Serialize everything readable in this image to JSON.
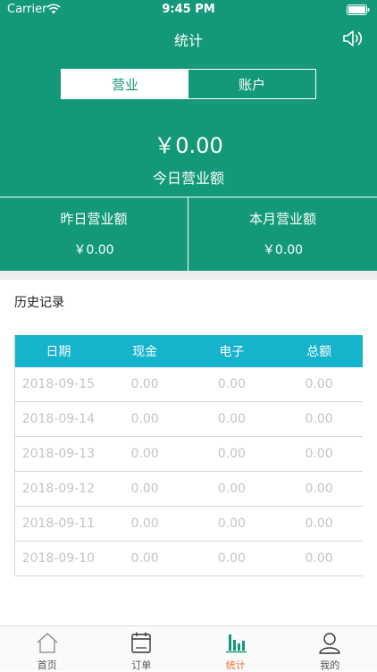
{
  "status_bar": {
    "carrier": "Carrier",
    "time": "9:45 PM"
  },
  "nav": {
    "title": "统计"
  },
  "segment": {
    "tabs": [
      "营业",
      "账户"
    ],
    "active_index": 0
  },
  "today": {
    "amount": "￥0.00",
    "label": "今日营业额"
  },
  "stats": {
    "yesterday": {
      "label": "昨日营业额",
      "value": "￥0.00"
    },
    "month": {
      "label": "本月营业额",
      "value": "￥0.00"
    }
  },
  "history": {
    "title": "历史记录",
    "headers": [
      "日期",
      "现金",
      "电子",
      "总额"
    ],
    "rows": [
      [
        "2018-09-15",
        "0.00",
        "0.00",
        "0.00"
      ],
      [
        "2018-09-14",
        "0.00",
        "0.00",
        "0.00"
      ],
      [
        "2018-09-13",
        "0.00",
        "0.00",
        "0.00"
      ],
      [
        "2018-09-12",
        "0.00",
        "0.00",
        "0.00"
      ],
      [
        "2018-09-11",
        "0.00",
        "0.00",
        "0.00"
      ],
      [
        "2018-09-10",
        "0.00",
        "0.00",
        "0.00"
      ]
    ]
  },
  "tabbar": {
    "items": [
      {
        "label": "首页",
        "icon": "home-icon"
      },
      {
        "label": "订单",
        "icon": "calendar-icon"
      },
      {
        "label": "统计",
        "icon": "bar-chart-icon"
      },
      {
        "label": "我的",
        "icon": "user-icon"
      }
    ],
    "active_index": 2
  },
  "colors": {
    "primary": "#13997a",
    "table_header": "#15b3cc",
    "active_tab_label": "#e8713a"
  }
}
